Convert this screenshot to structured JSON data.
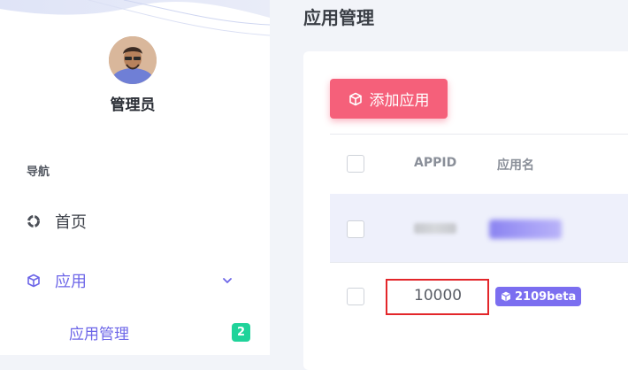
{
  "sidebar": {
    "admin_name": "管理员",
    "nav_heading": "导航",
    "items": [
      {
        "label": "首页",
        "icon": "pie-chart-icon"
      },
      {
        "label": "应用",
        "icon": "cube-icon",
        "expanded": true
      }
    ],
    "sub_items": [
      {
        "label": "应用管理",
        "badge": "2"
      }
    ]
  },
  "page": {
    "title": "应用管理",
    "add_button_label": "添加应用"
  },
  "table": {
    "headers": [
      "APPID",
      "应用名"
    ],
    "rows": [
      {
        "appid": "",
        "name": "",
        "redacted": true
      },
      {
        "appid": "10000",
        "version": "2109beta"
      }
    ]
  },
  "colors": {
    "accent": "#6d66e8",
    "add_button": "#f5607a",
    "badge_green": "#1fd39a",
    "version_badge": "#7b6ef0",
    "highlight_box": "#e3262a"
  }
}
